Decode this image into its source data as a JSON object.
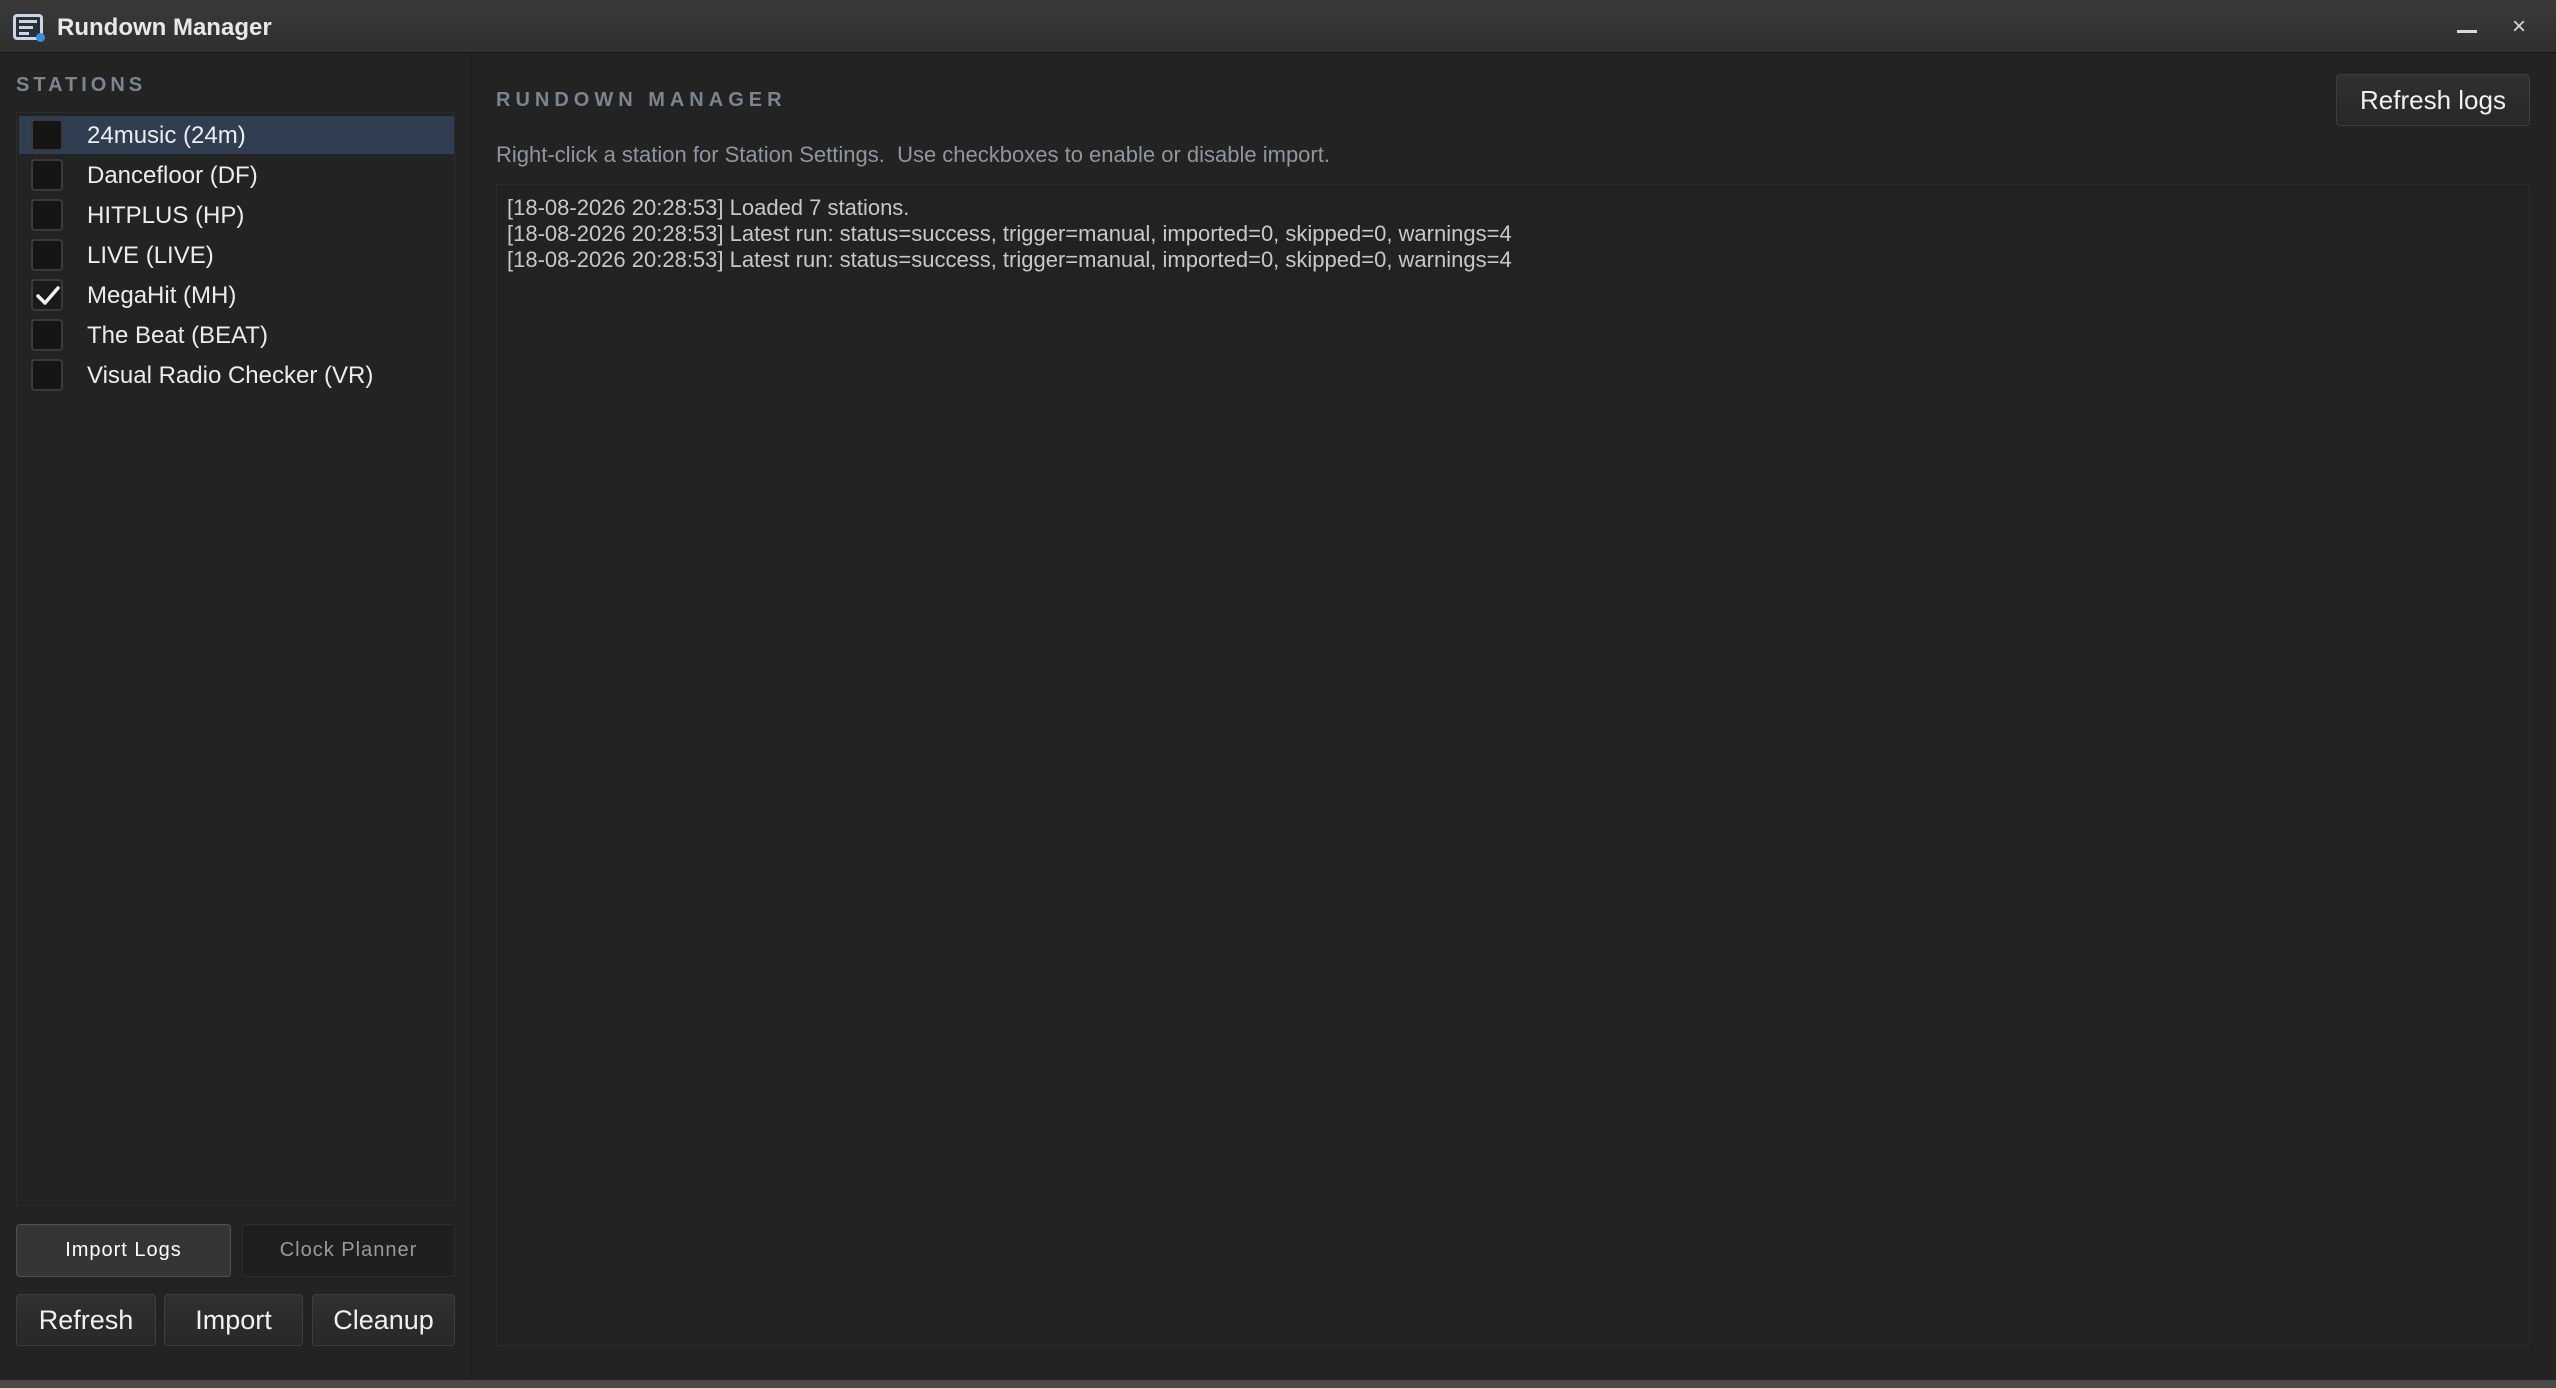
{
  "window": {
    "title": "Rundown Manager"
  },
  "sidebar": {
    "header": "STATIONS",
    "stations": [
      {
        "label": "24music (24m)",
        "checked": false,
        "selected": true
      },
      {
        "label": "Dancefloor (DF)",
        "checked": false,
        "selected": false
      },
      {
        "label": "HITPLUS (HP)",
        "checked": false,
        "selected": false
      },
      {
        "label": "LIVE (LIVE)",
        "checked": false,
        "selected": false
      },
      {
        "label": "MegaHit (MH)",
        "checked": true,
        "selected": false
      },
      {
        "label": "The Beat (BEAT)",
        "checked": false,
        "selected": false
      },
      {
        "label": "Visual Radio Checker (VR)",
        "checked": false,
        "selected": false
      }
    ],
    "tabs": {
      "import_logs": "Import  Logs",
      "clock_planner": "Clock Planner"
    },
    "buttons": {
      "refresh": "Refresh",
      "import": "Import",
      "cleanup": "Cleanup"
    }
  },
  "main": {
    "header": "RUNDOWN MANAGER",
    "hint": "Right-click a station for Station Settings.  Use checkboxes to enable or disable import.",
    "refresh_logs_label": "Refresh logs",
    "log_lines": [
      "[18-08-2026 20:28:53] Loaded 7 stations.",
      "[18-08-2026 20:28:53] Latest run: status=success, trigger=manual, imported=0, skipped=0, warnings=4",
      "[18-08-2026 20:28:53] Latest run: status=success, trigger=manual, imported=0, skipped=0, warnings=4"
    ]
  },
  "icons": {
    "app": "rundown-app-icon",
    "minimize": "minimize-icon",
    "close": "close-icon",
    "check": "checkmark-icon"
  },
  "colors": {
    "selection": "#2f3e50",
    "background": "#232323",
    "header_text": "#7b8590"
  }
}
